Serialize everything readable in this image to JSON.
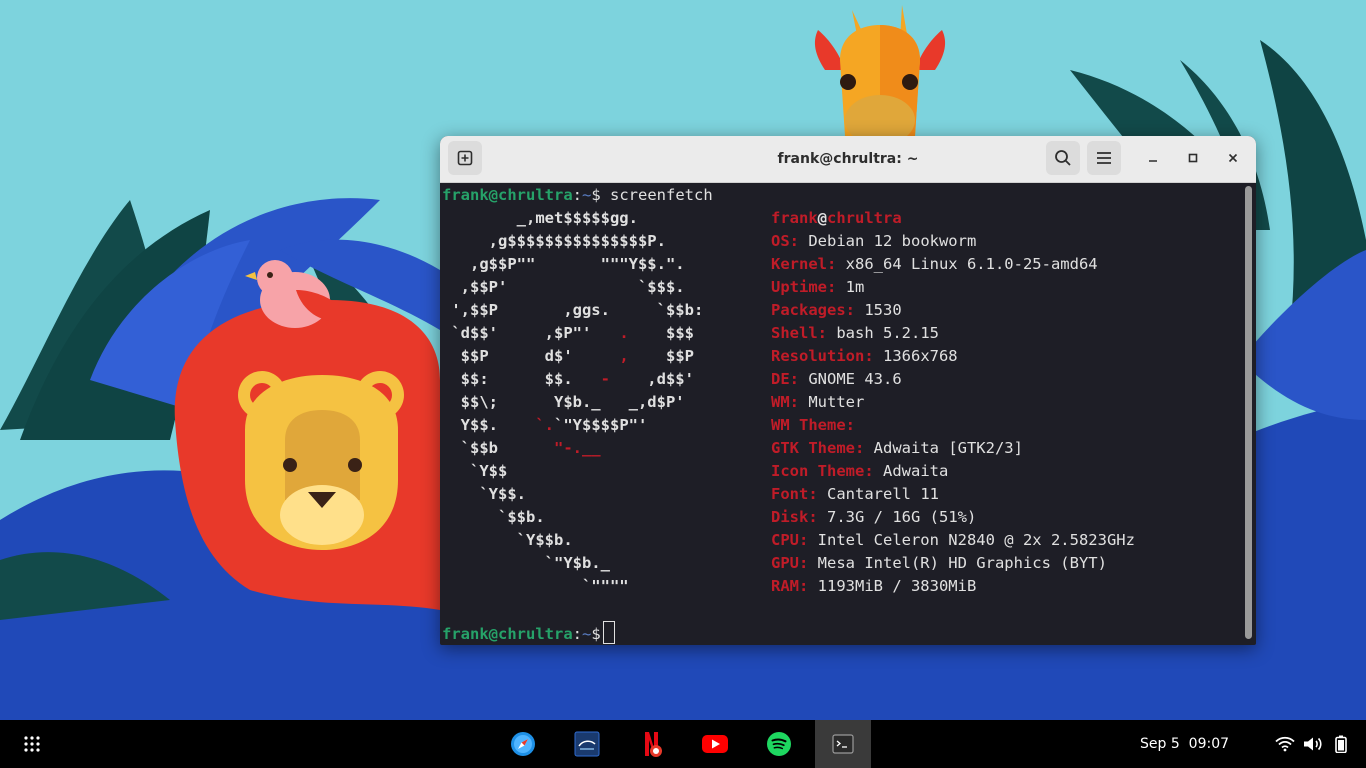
{
  "window": {
    "title": "frank@chrultra: ~"
  },
  "terminal": {
    "prompt_user_host": "frank@chrultra",
    "prompt_sep": ":",
    "prompt_path": "~",
    "prompt_symbol": "$",
    "command": " screenfetch",
    "art": [
      [
        {
          "t": "        _,met$$$$$gg.",
          "c": "w"
        }
      ],
      [
        {
          "t": "     ,g$$$$$$$$$$$$$$$P.",
          "c": "w"
        }
      ],
      [
        {
          "t": "   ,g$$P\"\"       \"\"\"Y$$.\".",
          "c": "w"
        }
      ],
      [
        {
          "t": "  ,$$P'              `$$$.",
          "c": "w"
        }
      ],
      [
        {
          "t": " ',$$P       ,ggs.     `$$b:",
          "c": "w"
        }
      ],
      [
        {
          "t": " `d$$'     ,$P\"'   ",
          "c": "w"
        },
        {
          "t": ".",
          "c": "r"
        },
        {
          "t": "    $$$",
          "c": "w"
        }
      ],
      [
        {
          "t": "  $$P      d$'     ",
          "c": "w"
        },
        {
          "t": ",",
          "c": "r"
        },
        {
          "t": "    $$P",
          "c": "w"
        }
      ],
      [
        {
          "t": "  $$:      $$.   ",
          "c": "w"
        },
        {
          "t": "-",
          "c": "r"
        },
        {
          "t": "    ,d$$'",
          "c": "w"
        }
      ],
      [
        {
          "t": "  $$\\;      Y$b._   _,d$P'",
          "c": "w"
        }
      ],
      [
        {
          "t": "  Y$$.    ",
          "c": "w"
        },
        {
          "t": "`.",
          "c": "r"
        },
        {
          "t": "`\"Y$$$$P\"'",
          "c": "w"
        }
      ],
      [
        {
          "t": "  `$$b      ",
          "c": "w"
        },
        {
          "t": "\"-.__",
          "c": "r"
        }
      ],
      [
        {
          "t": "   `Y$$",
          "c": "w"
        }
      ],
      [
        {
          "t": "    `Y$$.",
          "c": "w"
        }
      ],
      [
        {
          "t": "      `$$b.",
          "c": "w"
        }
      ],
      [
        {
          "t": "        `Y$$b.",
          "c": "w"
        }
      ],
      [
        {
          "t": "           `\"Y$b._",
          "c": "w"
        }
      ],
      [
        {
          "t": "               `\"\"\"\"",
          "c": "w"
        }
      ]
    ],
    "info_user": "frank",
    "info_at": "@",
    "info_host": "chrultra",
    "info": [
      {
        "label": "OS:",
        "value": " Debian 12 bookworm"
      },
      {
        "label": "Kernel:",
        "value": " x86_64 Linux 6.1.0-25-amd64"
      },
      {
        "label": "Uptime:",
        "value": " 1m"
      },
      {
        "label": "Packages:",
        "value": " 1530"
      },
      {
        "label": "Shell:",
        "value": " bash 5.2.15"
      },
      {
        "label": "Resolution:",
        "value": " 1366x768"
      },
      {
        "label": "DE:",
        "value": " GNOME 43.6"
      },
      {
        "label": "WM:",
        "value": " Mutter"
      },
      {
        "label": "WM Theme:",
        "value": ""
      },
      {
        "label": "GTK Theme:",
        "value": " Adwaita [GTK2/3]"
      },
      {
        "label": "Icon Theme:",
        "value": " Adwaita"
      },
      {
        "label": "Font:",
        "value": " Cantarell 11"
      },
      {
        "label": "Disk:",
        "value": " 7.3G / 16G (51%)"
      },
      {
        "label": "CPU:",
        "value": " Intel Celeron N2840 @ 2x 2.5823GHz"
      },
      {
        "label": "GPU:",
        "value": " Mesa Intel(R) HD Graphics (BYT)"
      },
      {
        "label": "RAM:",
        "value": " 1193MiB / 3830MiB"
      }
    ]
  },
  "taskbar": {
    "date": "Sep 5",
    "time": "09:07",
    "apps": [
      "app-grid",
      "safari-browser",
      "disney-plus",
      "netflix",
      "youtube",
      "spotify",
      "terminal"
    ]
  },
  "colors": {
    "terminal_bg": "#1e1e26",
    "prompt_green": "#26a269",
    "path_blue": "#5a7ec4",
    "debian_red": "#c01c28",
    "wallpaper_sky": "#7dd3dd",
    "wallpaper_blue": "#2049b8"
  }
}
